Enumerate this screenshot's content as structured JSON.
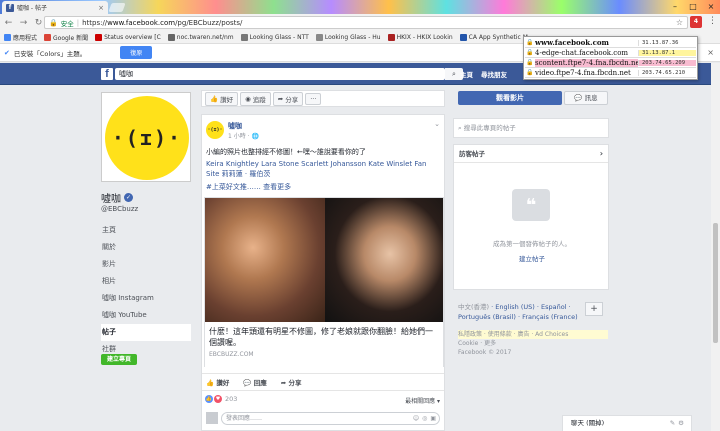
{
  "browser": {
    "tab_title": "噓咖 - 帖子",
    "omnibox": {
      "secure_label": "安全",
      "url_prefix": "https://",
      "url_host": "www.facebook.com",
      "url_path": "/pg/EBCbuzz/posts/"
    },
    "extension_badge": "4",
    "bookmarks": [
      {
        "label": "應用程式",
        "color": "#4285f4"
      },
      {
        "label": "Google 新聞",
        "color": "#db4437"
      },
      {
        "label": "Status overview [C",
        "color": "#cc0000"
      },
      {
        "label": "noc.twaren.net/nm",
        "color": "#666666"
      },
      {
        "label": "Looking Glass - NTT",
        "color": "#777777"
      },
      {
        "label": "Looking Glass - Hu",
        "color": "#888888"
      },
      {
        "label": "HKIX - HKIX Lookin",
        "color": "#aa2222"
      },
      {
        "label": "CA App Synthetic M",
        "color": "#2255aa"
      }
    ],
    "infobar": {
      "message": "已安裝「Colors」主題。",
      "undo_label": "復原"
    }
  },
  "ip_popup": [
    {
      "host": "www.facebook.com",
      "ip": "31.13.87.36"
    },
    {
      "host": "4-edge-chat.facebook.com",
      "ip": "31.13.87.1"
    },
    {
      "host": "scontent.ftpe7-4.fna.fbcdn.net",
      "ip": "203.74.65.209"
    },
    {
      "host": "video.ftpe7-4.fna.fbcdn.net",
      "ip": "203.74.65.210"
    }
  ],
  "facebook": {
    "search_value": "噓咖",
    "nav": [
      "主頁",
      "尋找朋友"
    ],
    "page": {
      "name": "噓咖",
      "handle": "@EBCbuzz",
      "avatar_text": "·(ɪ)·",
      "nav": [
        {
          "label": "主頁"
        },
        {
          "label": "關於"
        },
        {
          "label": "影片"
        },
        {
          "label": "相片"
        },
        {
          "label": "噓咖 Instagram"
        },
        {
          "label": "噓咖 YouTube"
        },
        {
          "label": "帖子",
          "active": true
        },
        {
          "label": "社群"
        }
      ],
      "create_page": "建立專頁"
    },
    "actions": {
      "like": "讚好",
      "follow": "追蹤",
      "share": "分享",
      "more": "···"
    },
    "post": {
      "author": "噓咖",
      "avatar_text": "·(ɪ)·",
      "time": "1 小時",
      "text": "小編的照片也整排經不修圖！←嘿～誰說要看你的了",
      "links": "Keira Knightley Lara Stone Scarlett Johansson Kate Winslet Fan Site 莉莉蓮 · 羅伯茨",
      "tags": "#上菜好文推……",
      "see_more": "查看更多",
      "link_title": "什麼！這年頭還有明星不修圖，修了老娘就跟你翻臉！給她們一個讚喔。",
      "link_source": "EBCBUZZ.COM",
      "buttons": [
        "讚好",
        "回應",
        "分享"
      ],
      "reaction_count": "203",
      "relevance": "最相關回應",
      "comment_placeholder": "發表回應……"
    },
    "right": {
      "watch_video": "觀看影片",
      "message": "訊息",
      "search_placeholder": "搜尋此專頁的帖子",
      "panel_title": "訪客帖子",
      "empty_msg": "成為第一個發佈帖子的人。",
      "create_post": "建立帖子",
      "languages": {
        "current": "中文(香港)",
        "others": "English (US) · Español · Português (Brasil) · Français (France)"
      },
      "footer_line1": "私隱政策 · 使用條款 · 廣告 · Ad Choices",
      "footer_line2": "Cookie · 更多",
      "footer_line3": "Facebook © 2017"
    },
    "chat": {
      "label": "聊天 (關掉)"
    }
  }
}
